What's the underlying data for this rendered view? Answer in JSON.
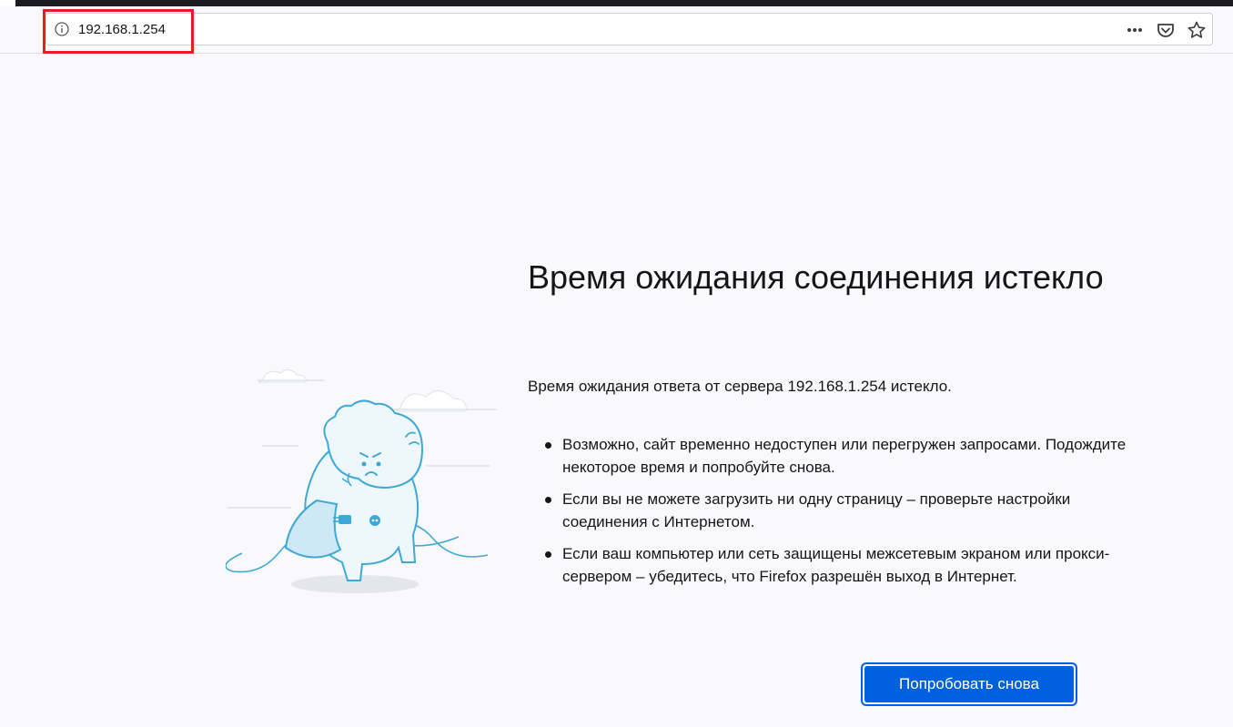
{
  "address_bar": {
    "url": "192.168.1.254"
  },
  "icons": {
    "info": "info-icon",
    "page_actions": "more-icon",
    "pocket": "pocket-icon",
    "bookmark": "star-icon"
  },
  "colors": {
    "accent": "#0061e0",
    "highlight": "#e31e24",
    "illustration": "#3fa9d6"
  },
  "error": {
    "title": "Время ожидания соединения истекло",
    "description": "Время ожидания ответа от сервера 192.168.1.254 истекло.",
    "tips": [
      "Возможно, сайт временно недоступен или перегружен запросами. Подождите некоторое время и попробуйте снова.",
      "Если вы не можете загрузить ни одну страницу – проверьте настройки соединения с Интернетом.",
      "Если ваш компьютер или сеть защищены межсетевым экраном или прокси-сервером – убедитесь, что Firefox разрешён выход в Интернет."
    ],
    "retry_label": "Попробовать снова"
  }
}
